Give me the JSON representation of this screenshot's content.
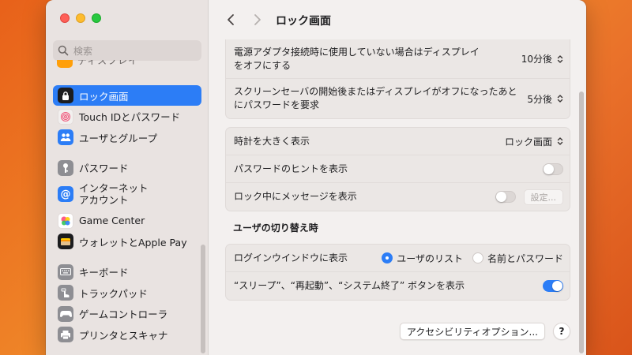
{
  "sidebar": {
    "search_placeholder": "検索",
    "cut_item_label": "ディスプレイ",
    "items": [
      {
        "label": "ロック画面",
        "icon": "lock-icon",
        "color": "#1c1c1e",
        "selected": true
      },
      {
        "label": "Touch IDとパスワード",
        "icon": "fingerprint-icon",
        "color": "#f2f0ef"
      },
      {
        "label": "ユーザとグループ",
        "icon": "users-icon",
        "color": "#2c7df6"
      },
      {
        "label": "パスワード",
        "icon": "key-icon",
        "color": "#8e8e93"
      },
      {
        "label": "インターネット\nアカウント",
        "icon": "at-icon",
        "color": "#2c7df6"
      },
      {
        "label": "Game Center",
        "icon": "game-center-icon",
        "color": "#ffffff"
      },
      {
        "label": "ウォレットとApple Pay",
        "icon": "wallet-icon",
        "color": "#1c1c1e"
      },
      {
        "label": "キーボード",
        "icon": "keyboard-icon",
        "color": "#8e8e93"
      },
      {
        "label": "トラックパッド",
        "icon": "trackpad-icon",
        "color": "#8e8e93"
      },
      {
        "label": "ゲームコントローラ",
        "icon": "game-controller-icon",
        "color": "#8e8e93"
      },
      {
        "label": "プリンタとスキャナ",
        "icon": "printer-icon",
        "color": "#8e8e93"
      }
    ]
  },
  "header": {
    "title": "ロック画面"
  },
  "display_group": {
    "rows": [
      {
        "label": "電源アダプタ接続時に使用していない場合はディスプレイ\nをオフにする",
        "value": "10分後"
      },
      {
        "label": "スクリーンセーバの開始後またはディスプレイがオフになったあと\nにパスワードを要求",
        "value": "5分後"
      }
    ]
  },
  "options_group": {
    "large_clock_label": "時計を大きく表示",
    "large_clock_value": "ロック画面",
    "password_hint_label": "パスワードのヒントを表示",
    "password_hint_on": false,
    "message_label": "ロック中にメッセージを表示",
    "message_on": false,
    "message_settings_button": "設定..."
  },
  "user_switch": {
    "section_title": "ユーザの切り替え時",
    "login_window_label": "ログインウインドウに表示",
    "radio_users": "ユーザのリスト",
    "radio_name_password": "名前とパスワード",
    "selected": "users",
    "buttons_label": "“スリープ”、“再起動”、“システム終了” ボタンを表示",
    "buttons_on": true
  },
  "footer": {
    "accessibility_button": "アクセシビリティオプション...",
    "help_button": "?"
  },
  "colors": {
    "accent": "#2c7df6",
    "traffic_close": "#fe5f57",
    "traffic_min": "#febc2e",
    "traffic_max": "#28c840"
  }
}
